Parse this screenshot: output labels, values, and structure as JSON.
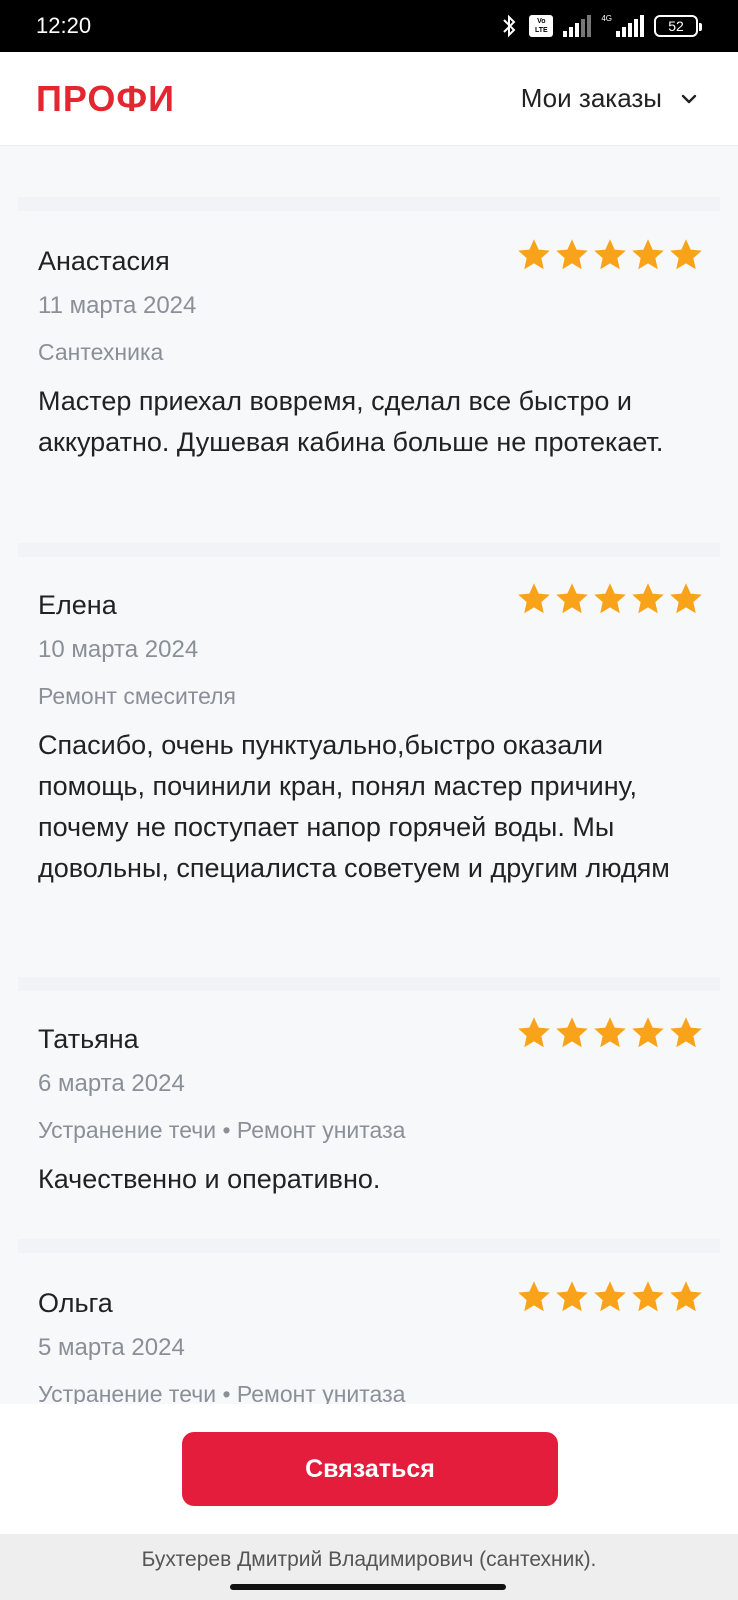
{
  "status_bar": {
    "time": "12:20",
    "network": "4G",
    "battery": "52",
    "icons": [
      "bluetooth-icon",
      "volte-icon",
      "signal-icon",
      "signal-4g-icon",
      "battery-icon"
    ]
  },
  "header": {
    "logo": "ПРОФИ",
    "menu_label": "Мои заказы",
    "menu_icon": "chevron-down-icon"
  },
  "colors": {
    "brand": "#e3262f",
    "button": "#e31d3b",
    "star": "#f9a31a",
    "muted": "#8a8f98"
  },
  "reviews": [
    {
      "name": "Анастасия",
      "date": "11 марта 2024",
      "category": "Сантехника",
      "text": "Мастер приехал вовремя, сделал все быстро и аккуратно. Душевая кабина больше не протекает.",
      "rating": 5
    },
    {
      "name": "Елена",
      "date": "10 марта 2024",
      "category": "Ремонт смесителя",
      "text": "Спасибо, очень пунктуально,быстро оказали помощь, починили кран, понял мастер причину, почему не поступает напор горячей воды. Мы довольны, специалиста советуем и другим людям",
      "rating": 5
    },
    {
      "name": "Татьяна",
      "date": "6 марта 2024",
      "category": "Устранение течи • Ремонт унитаза",
      "text": "Качественно и оперативно.",
      "rating": 5
    },
    {
      "name": "Ольга",
      "date": "5 марта 2024",
      "category": "Устранение течи • Ремонт унитаза",
      "text": "",
      "rating": 5
    }
  ],
  "action": {
    "contact_label": "Связаться"
  },
  "footer": {
    "master_name": "Бухтерев Дмитрий Владимирович (сантехник)."
  }
}
